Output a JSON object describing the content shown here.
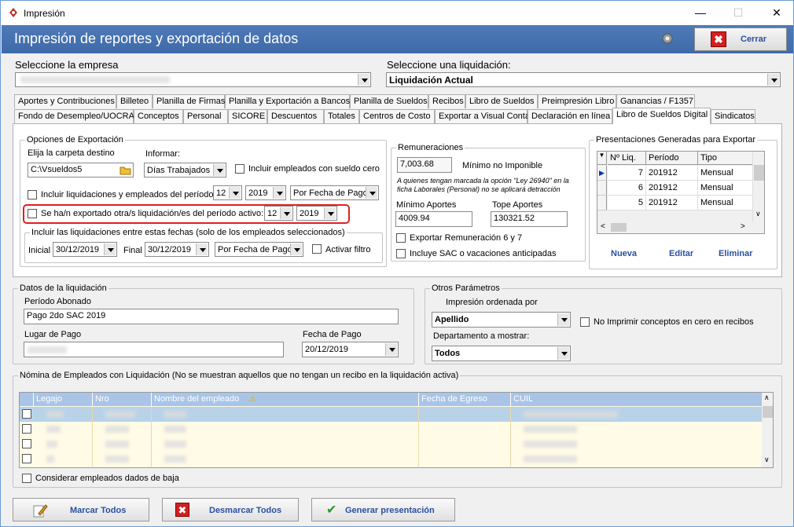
{
  "window": {
    "title": "Impresión",
    "banner": "Impresión de reportes y exportación de datos",
    "close_label": "Cerrar"
  },
  "empresa": {
    "label": "Seleccione la empresa"
  },
  "liquidacion": {
    "label": "Seleccione una liquidación:",
    "value": "Liquidación Actual"
  },
  "tabs_row1": [
    "Aportes y Contribuciones",
    "Billeteo",
    "Planilla de Firmas",
    "Planilla y Exportación a Bancos",
    "Planilla de Sueldos",
    "Recibos",
    "Libro de Sueldos",
    "Preimpresión Libro",
    "Ganancias / F1357"
  ],
  "tabs_row2": [
    "Fondo de Desempleo/UOCRA",
    "Conceptos",
    "Personal",
    "SICORE",
    "Descuentos",
    "Totales",
    "Centros de Costo",
    "Exportar a Visual Conta",
    "Declaración en línea",
    "Libro de Sueldos Digital",
    "Sindicatos"
  ],
  "export": {
    "title": "Opciones de Exportación",
    "folder_label": "Elija la carpeta destino",
    "folder_value": "C:\\Vsueldos5",
    "informar_label": "Informar:",
    "informar_value": "Días Trabajados",
    "incluir_cero": "Incluir empleados con sueldo cero",
    "incluir_periodo": "Incluir liquidaciones y empleados del período:",
    "periodo_mes": "12",
    "periodo_anio": "2019",
    "orden": "Por Fecha de Pago",
    "exportado": "Se ha/n exportado otra/s liquidación/es del período activo:",
    "exp_mes": "12",
    "exp_anio": "2019",
    "fechas_title": "Incluir las liquidaciones entre estas fechas (solo de los empleados seleccionados)",
    "inicial_label": "Inicial",
    "inicial": "30/12/2019",
    "final_label": "Final",
    "final": "30/12/2019",
    "orden2": "Por Fecha de Pago",
    "activar_filtro": "Activar filtro"
  },
  "remun": {
    "title": "Remuneraciones",
    "minimo_val": "7,003.68",
    "minimo_label": "Mínimo no Imponible",
    "nota": "A quienes tengan marcada la opción \"Ley 26940\" en la ficha Laborales (Personal) no se aplicará detracción",
    "min_aportes_label": "Mínimo Aportes",
    "min_aportes": "4009.94",
    "tope_label": "Tope Aportes",
    "tope": "130321.52",
    "exportar_6_7": "Exportar Remuneración 6 y 7",
    "sac": "Incluye SAC o vacaciones anticipadas"
  },
  "presentaciones": {
    "title": "Presentaciones Generadas para Exportar",
    "cols": [
      "Nº Liq.",
      "Período",
      "Tipo"
    ],
    "rows": [
      [
        "7",
        "201912",
        "Mensual"
      ],
      [
        "6",
        "201912",
        "Mensual"
      ],
      [
        "5",
        "201912",
        "Mensual"
      ]
    ],
    "nueva": "Nueva",
    "editar": "Editar",
    "eliminar": "Eliminar"
  },
  "datos": {
    "title": "Datos de la liquidación",
    "periodo_label": "Período Abonado",
    "periodo": "Pago 2do SAC 2019",
    "lugar_label": "Lugar de Pago",
    "fecha_label": "Fecha de Pago",
    "fecha": "20/12/2019"
  },
  "otros": {
    "title": "Otros Parámetros",
    "orden_label": "Impresión ordenada por",
    "orden": "Apellido",
    "no_imprimir": "No Imprimir conceptos en cero en recibos",
    "depto_label": "Departamento a mostrar:",
    "depto": "Todos"
  },
  "nomina": {
    "title": "Nómina de Empleados con Liquidación (No se muestran aquellos que no tengan un recibo en la liquidación activa)",
    "cols": [
      "Legajo",
      "Nro",
      "Nombre del empleado",
      "Fecha de Egreso",
      "CUIL"
    ],
    "baja": "Considerar empleados dados de baja"
  },
  "footer": {
    "marcar": "Marcar Todos",
    "desmarcar": "Desmarcar Todos",
    "generar": "Generar presentación"
  },
  "colors": {
    "banner": "#4472b0",
    "accent": "#2a50a0",
    "grid_header": "#a9c4e6",
    "highlight": "#e02020"
  }
}
